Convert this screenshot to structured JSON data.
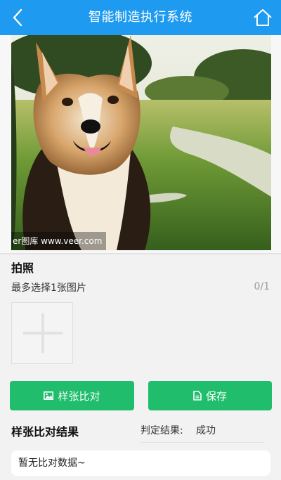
{
  "header": {
    "title": "智能制造执行系统",
    "back_icon": "chevron-left-icon",
    "home_icon": "home-icon",
    "color": "#1e9bf0"
  },
  "photo": {
    "watermark": "er图库 www.veer.com"
  },
  "upload": {
    "section_title": "拍照",
    "hint": "最多选择1张图片",
    "count": "0/1",
    "add_icon": "plus-icon"
  },
  "actions": {
    "compare_label": "样张比对",
    "compare_icon": "image-icon",
    "save_label": "保存",
    "save_icon": "document-icon",
    "color": "#1fbd6c"
  },
  "result": {
    "title": "样张比对结果",
    "judge_label": "判定结果:",
    "judge_value": "成功",
    "empty_text": "暂无比对数据~"
  }
}
